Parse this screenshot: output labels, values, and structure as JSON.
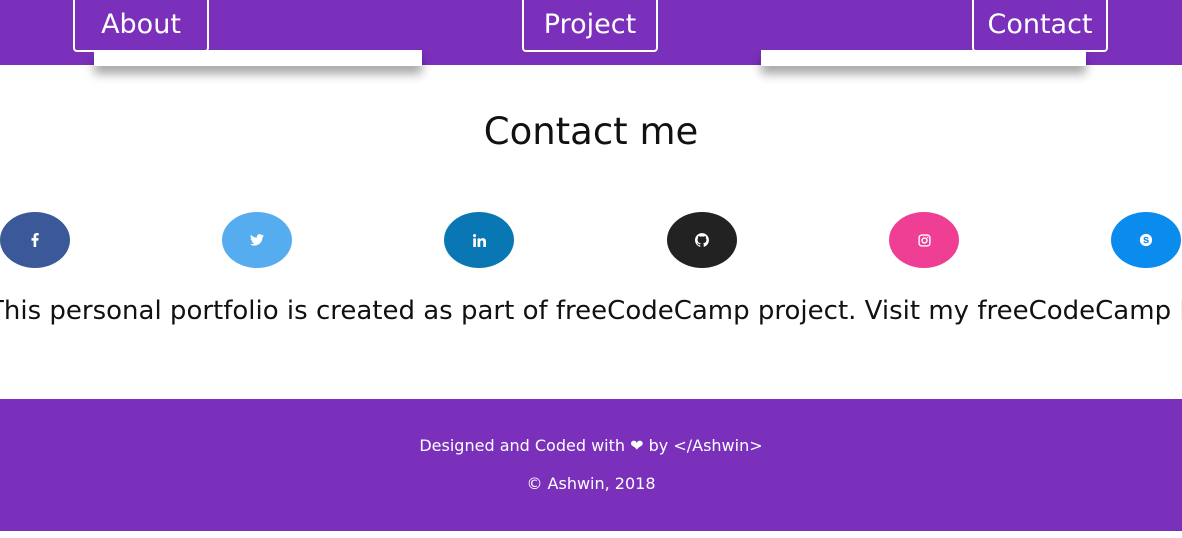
{
  "nav": {
    "about_label": "About",
    "project_label": "Project",
    "contact_label": "Contact"
  },
  "contact": {
    "title": "Contact me",
    "social_links": [
      {
        "name": "facebook",
        "icon": "facebook-icon",
        "color": "#3b5998"
      },
      {
        "name": "twitter",
        "icon": "twitter-icon",
        "color": "#55acee"
      },
      {
        "name": "linkedin",
        "icon": "linkedin-icon",
        "color": "#0a77b5"
      },
      {
        "name": "github",
        "icon": "github-icon",
        "color": "#222222"
      },
      {
        "name": "instagram",
        "icon": "instagram-icon",
        "color": "#ee3f95"
      },
      {
        "name": "skype",
        "icon": "skype-icon",
        "color": "#0a8cef"
      }
    ],
    "note_prefix": "This personal portfolio is created as part of freeCodeCamp project. Visit my ",
    "note_link": "freeCodeCamp Profile"
  },
  "footer": {
    "line1_prefix": "Designed and Coded with",
    "line1_suffix": "by </Ashwin>",
    "line2": "© Ashwin, 2018"
  },
  "colors": {
    "brand_purple": "#7a30bb"
  }
}
